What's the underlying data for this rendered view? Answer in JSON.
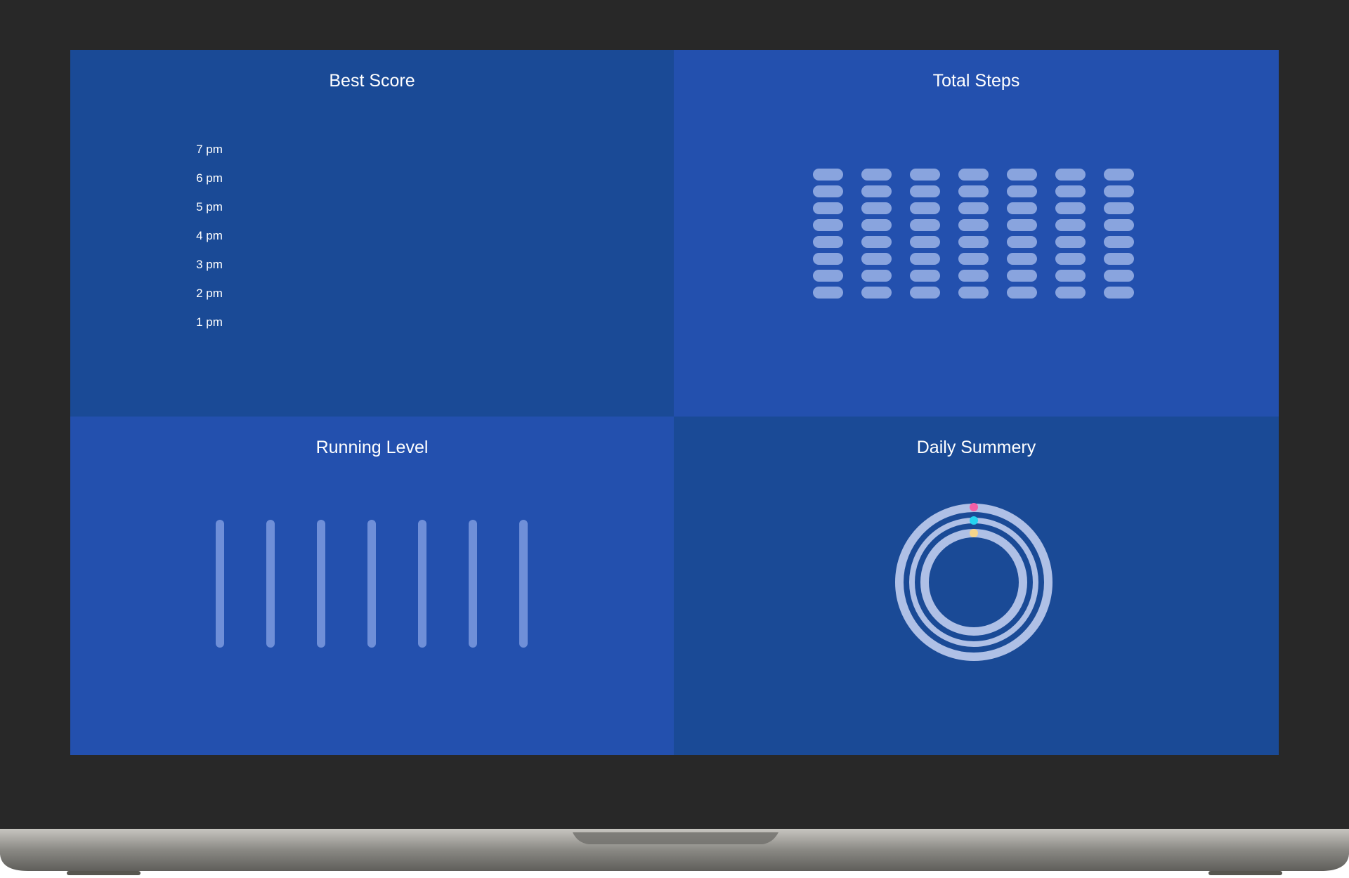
{
  "panels": {
    "best_score": {
      "title": "Best Score",
      "times": [
        "7 pm",
        "6 pm",
        "5 pm",
        "4 pm",
        "3 pm",
        "2 pm",
        "1 pm"
      ]
    },
    "total_steps": {
      "title": "Total Steps",
      "columns": 7,
      "pills_per_column": 8
    },
    "running_level": {
      "title": "Running Level",
      "bars": 7
    },
    "daily_summary": {
      "title": "Daily Summery",
      "ring_colors": [
        "#F25FA6",
        "#25D4F0",
        "#F6D58B"
      ]
    }
  }
}
